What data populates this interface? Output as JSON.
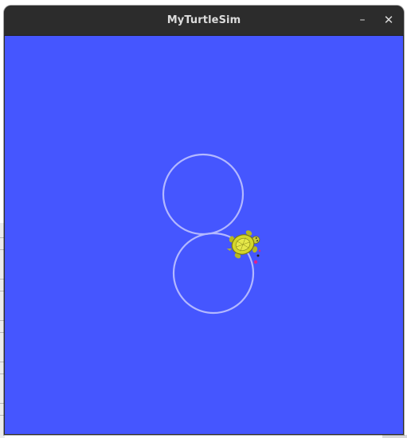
{
  "window": {
    "title": "MyTurtleSim",
    "minimize_glyph": "–",
    "close_glyph": "✕",
    "minimize_icon": "minimize-icon",
    "close_icon": "close-icon"
  },
  "canvas": {
    "background_color": "#4556ff",
    "pen_color": "#b3b8ff",
    "turtle_icon": "turtle-icon",
    "turtle_color": "#d4d62a"
  }
}
